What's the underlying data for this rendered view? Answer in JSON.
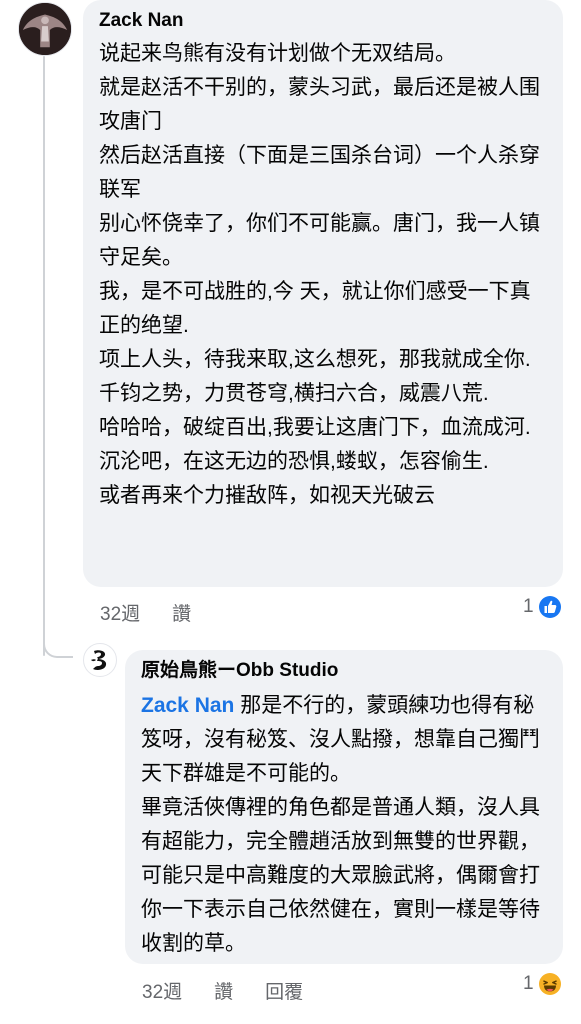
{
  "comment1": {
    "author": "Zack Nan",
    "paragraphs": [
      "说起来鸟熊有没有计划做个无双结局。",
      "就是赵活不干别的，蒙头习武，最后还是被人围攻唐门",
      "然后赵活直接（下面是三国杀台词）一个人杀穿联军",
      "别心怀侥幸了，你们不可能赢。唐门，我一人镇守足矣。",
      "我，是不可战胜的,今 天，就让你们感受一下真正的绝望.",
      "项上人头，待我来取,这么想死，那我就成全你.",
      "千钧之势，力贯苍穹,横扫六合，威震八荒.",
      "哈哈哈，破绽百出,我要让这唐门下，血流成河.",
      "沉沦吧，在这无边的恐惧,蝼蚁，怎容偷生.",
      "或者再来个力摧敌阵，如视天光破云"
    ],
    "time": "32週",
    "like_label": "讚",
    "reaction_count": "1",
    "reaction_icon": "like-reaction-icon"
  },
  "comment2": {
    "author": "原始鳥熊ーObb Studio",
    "mention": "Zack Nan",
    "first_text": " 那是不行的，蒙頭練功也得有秘笈呀，沒有秘笈、沒人點撥，想靠自己獨鬥天下群雄是不可能的。",
    "paragraphs": [
      "畢竟活俠傳裡的角色都是普通人類，沒人具有超能力，完全體趙活放到無雙的世界觀，可能只是中高難度的大眾臉武將，偶爾會打你一下表示自己依然健在，實則一樣是等待收割的草。"
    ],
    "time": "32週",
    "like_label": "讚",
    "reply_label": "回覆",
    "reaction_count": "1",
    "reaction_icon": "haha-reaction-icon"
  },
  "colors": {
    "bubble": "#f0f2f5",
    "mention": "#1b74e4",
    "meta": "#65676b",
    "like_blue": "#1877f2",
    "haha_yellow": "#f7b125"
  }
}
